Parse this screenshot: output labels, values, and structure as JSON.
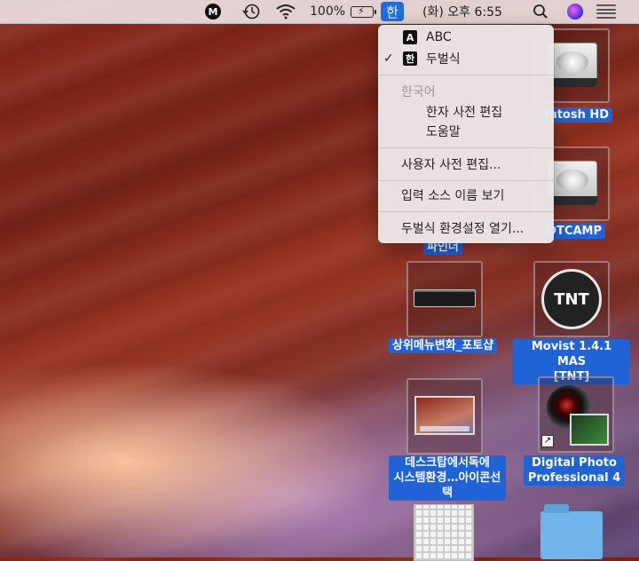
{
  "menubar": {
    "m_icon": "M",
    "battery_percent": "100%",
    "input_source": "한",
    "clock": "(화) 오후 6:55"
  },
  "ime_menu": {
    "items": [
      {
        "badge": "A",
        "label": "ABC",
        "checked": false
      },
      {
        "badge": "한",
        "label": "두벌식",
        "checked": true
      }
    ],
    "section_header": "한국어",
    "section_items": [
      "한자 사전 편집",
      "도움말"
    ],
    "user_dictionary": "사용자 사전 편집...",
    "show_input_source_name": "입력 소스 이름 보기",
    "open_preferences": "두벌식 환경설정 열기...",
    "checkmark": "✓"
  },
  "desktop": {
    "icons": [
      {
        "label": "intosh HD"
      },
      {
        "label": "OTCAMP"
      },
      {
        "label": "파인더"
      },
      {
        "label": "상위메뉴변화_포토샵"
      },
      {
        "label_line1": "Movist 1.4.1 MAS",
        "label_line2": "[TNT]",
        "logo_text": "TNT"
      },
      {
        "label_line1": "데스크탑에서독에",
        "label_line2": "시스템환경…아이콘선택"
      },
      {
        "label_line1": "Digital Photo",
        "label_line2": "Professional 4"
      }
    ]
  }
}
